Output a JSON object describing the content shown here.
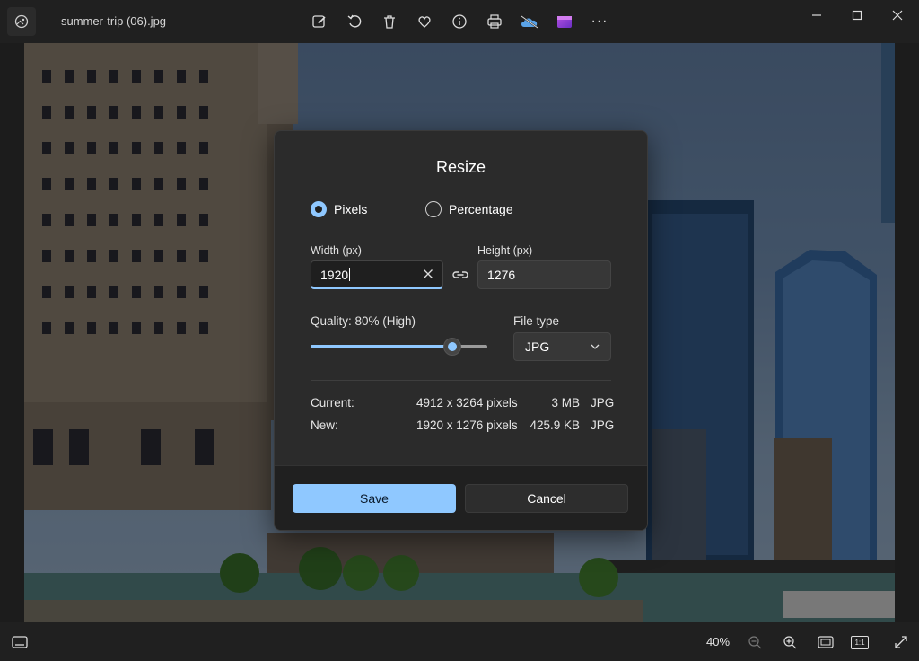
{
  "window": {
    "title": "summer-trip (06).jpg",
    "toolbar_icons": [
      "edit-icon",
      "rotate-icon",
      "delete-icon",
      "favorite-icon",
      "info-icon",
      "print-icon",
      "onedrive-icon",
      "clipchamp-icon",
      "more-icon"
    ],
    "more_label": "···"
  },
  "dialog": {
    "title": "Resize",
    "mode_options": {
      "pixels": "Pixels",
      "percentage": "Percentage",
      "selected": "Pixels"
    },
    "width_label": "Width  (px)",
    "height_label": "Height  (px)",
    "width_value": "1920",
    "height_value": "1276",
    "quality_label": "Quality: 80% (High)",
    "quality_value": 0.8,
    "file_type_label": "File type",
    "file_type_value": "JPG",
    "current": {
      "label": "Current:",
      "dimensions": "4912 x 3264 pixels",
      "size": "3 MB",
      "type": "JPG"
    },
    "new": {
      "label": "New:",
      "dimensions": "1920 x 1276 pixels",
      "size": "425.9 KB",
      "type": "JPG"
    },
    "save_label": "Save",
    "cancel_label": "Cancel"
  },
  "bottom": {
    "zoom": "40%",
    "actual_size_label": "1:1"
  },
  "colors": {
    "accent": "#8fc8ff",
    "dialog_bg": "#2b2b2b",
    "titlebar_bg": "#202020"
  }
}
